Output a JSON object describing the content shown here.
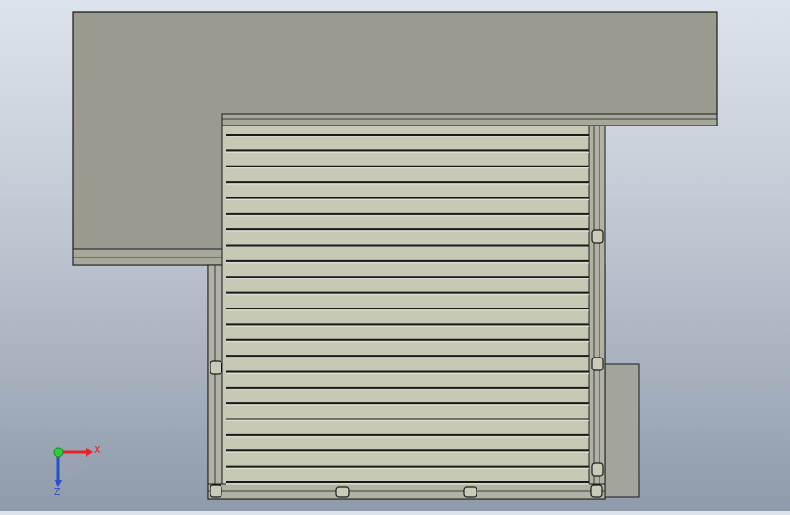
{
  "viewport": {
    "background_top": "#dde3ea",
    "background_bottom": "#8f9aab",
    "model": {
      "part_color": "#9a9a8e",
      "slat_color": "#c7c8b6",
      "edge_color": "#1a1a1a",
      "slat_count": 22
    },
    "triad": {
      "x_label": "X",
      "z_label": "Z",
      "x_color": "#e8202a",
      "y_color": "#2ecc40",
      "z_color": "#2a50c8"
    }
  }
}
